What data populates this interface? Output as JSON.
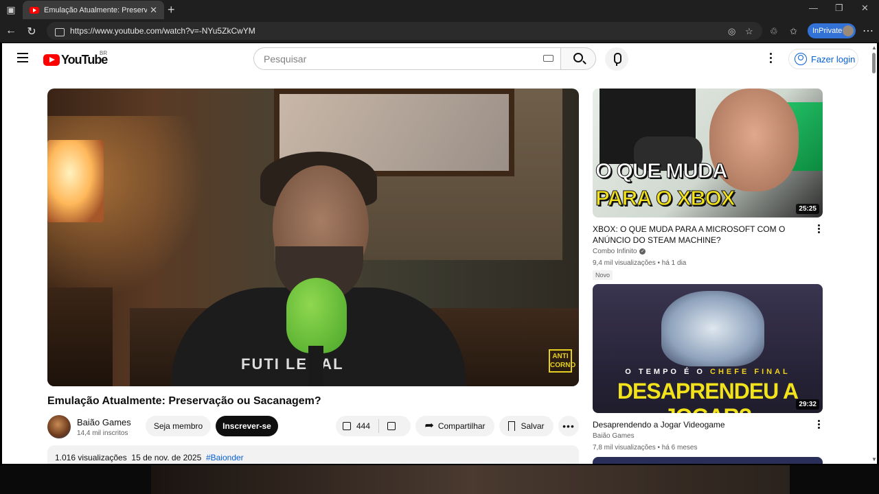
{
  "browser": {
    "tab_title": "Emulação Atualmente: Preservação",
    "url": "https://www.youtube.com/watch?v=-NYu5ZkCwYM",
    "inprivate_label": "InPrivate"
  },
  "masthead": {
    "logo_text": "YouTube",
    "country_code": "BR",
    "search_placeholder": "Pesquisar",
    "login_label": "Fazer login"
  },
  "video": {
    "title": "Emulação Atualmente: Preservação ou Sacanagem?",
    "overlay_logo": "ANTI CORNO",
    "shirt_text": "FUTI LEGAL",
    "channel_name": "Baião Games",
    "subscribers": "14,4 mil inscritos",
    "join_label": "Seja membro",
    "subscribe_label": "Inscrever-se",
    "likes": "444",
    "share_label": "Compartilhar",
    "save_label": "Salvar",
    "views": "1.016 visualizações",
    "date": "15 de nov. de 2025",
    "hashtag": "#Baionder"
  },
  "recommendations": [
    {
      "thumb_line1": "O QUE MUDA",
      "thumb_line2_pre": "PARA O ",
      "thumb_line2_hl": "XBOX AGORA?",
      "duration": "25:25",
      "title": "XBOX: O QUE MUDA PARA A MICROSOFT COM O ANÚNCIO DO STEAM MACHINE?",
      "channel": "Combo Infinito",
      "views": "9,4 mil visualizações",
      "age": "há 1 dia",
      "badge": "Novo"
    },
    {
      "thumb_sub_pre": "O TEMPO É O ",
      "thumb_sub_hl": "CHEFE FINAL",
      "thumb_big": "DESAPRENDEU A JOGAR?",
      "duration": "29:32",
      "title": "Desaprendendo a Jogar Videogame",
      "channel": "Baião Games",
      "views": "7,8 mil visualizações",
      "age": "há 6 meses"
    }
  ]
}
